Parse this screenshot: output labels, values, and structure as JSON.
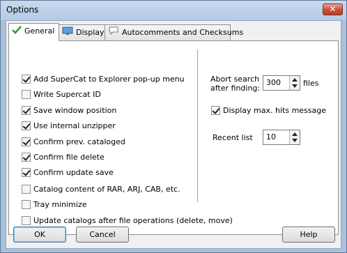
{
  "window": {
    "title": "Options",
    "close_glyph": "✕"
  },
  "tabs": [
    {
      "label": "General",
      "icon": "check-icon"
    },
    {
      "label": "Display",
      "icon": "monitor-icon"
    },
    {
      "label": "Autocomments and Checksums",
      "icon": "speech-bubble-icon"
    }
  ],
  "general": {
    "options": [
      {
        "label": "Add SuperCat to Explorer pop-up menu",
        "checked": true
      },
      {
        "label": "Write Supercat ID",
        "checked": false
      },
      {
        "label": "Save window position",
        "checked": true
      },
      {
        "label": "Use internal unzipper",
        "checked": true
      },
      {
        "label": "Confirm prev. cataloged",
        "checked": true
      },
      {
        "label": "Confirm file delete",
        "checked": true
      },
      {
        "label": "Confirm update save",
        "checked": true
      },
      {
        "label": "Catalog content of RAR, ARJ, CAB, etc.",
        "checked": false
      },
      {
        "label": "Tray minimize",
        "checked": false
      },
      {
        "label": "Update catalogs after file operations (delete, move)",
        "checked": false
      }
    ],
    "abort_search": {
      "label_line1": "Abort search",
      "label_line2": "after finding:",
      "value": "300",
      "unit": "files"
    },
    "display_max_hits": {
      "label": "Display max. hits message",
      "checked": true
    },
    "recent_list": {
      "label": "Recent list",
      "value": "10"
    }
  },
  "buttons": {
    "ok": "OK",
    "cancel": "Cancel",
    "help": "Help"
  }
}
